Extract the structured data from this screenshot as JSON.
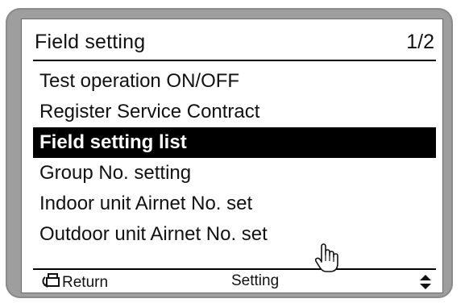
{
  "header": {
    "title": "Field setting",
    "page": "1/2"
  },
  "menu": {
    "items": [
      {
        "label": "Test operation ON/OFF",
        "selected": false
      },
      {
        "label": "Register Service Contract",
        "selected": false
      },
      {
        "label": "Field setting list",
        "selected": true
      },
      {
        "label": "Group No. setting",
        "selected": false
      },
      {
        "label": "Indoor unit Airnet No. set",
        "selected": false
      },
      {
        "label": "Outdoor unit Airnet No. set",
        "selected": false
      }
    ]
  },
  "footer": {
    "return_label": "Return",
    "setting_label": "Setting"
  },
  "icons": {
    "return": "return-icon",
    "updown": "up-down-arrow-icon",
    "cursor": "hand-cursor-icon"
  },
  "colors": {
    "bezel": "#9e9e9e",
    "highlight": "#000000",
    "screen_bg": "#ffffff"
  }
}
